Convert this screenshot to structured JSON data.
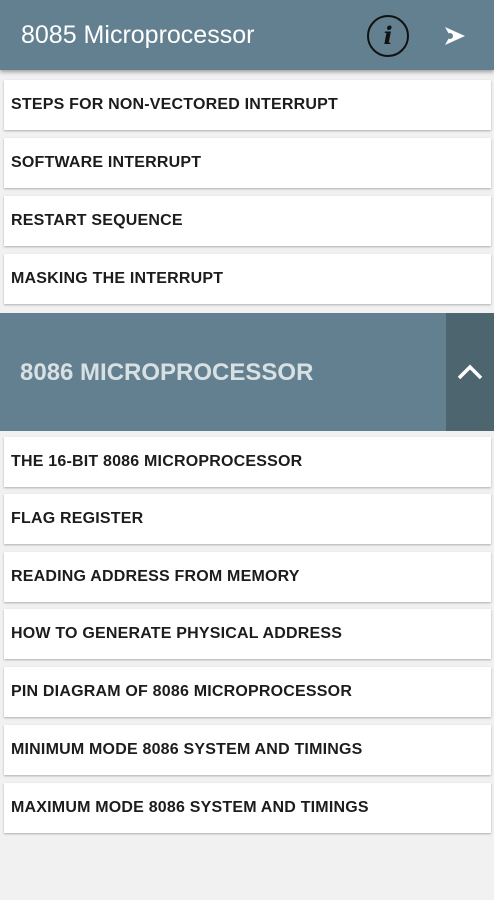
{
  "appbar": {
    "title": "8085 Microprocessor",
    "info_icon": "info-icon",
    "share_icon": "share-icon"
  },
  "group_8085": {
    "items": [
      {
        "label": "STEPS FOR NON-VECTORED INTERRUPT"
      },
      {
        "label": "SOFTWARE INTERRUPT"
      },
      {
        "label": "RESTART SEQUENCE"
      },
      {
        "label": "MASKING THE INTERRUPT"
      }
    ]
  },
  "group_8086": {
    "title": "8086 MICROPROCESSOR",
    "collapse_icon": "chevron-up-icon",
    "items": [
      {
        "label": "THE 16-BIT 8086 MICROPROCESSOR"
      },
      {
        "label": "FLAG REGISTER"
      },
      {
        "label": "READING ADDRESS FROM MEMORY"
      },
      {
        "label": "HOW TO GENERATE PHYSICAL ADDRESS"
      },
      {
        "label": "PIN DIAGRAM OF 8086 MICROPROCESSOR"
      },
      {
        "label": "MINIMUM MODE 8086 SYSTEM AND TIMINGS"
      },
      {
        "label": "MAXIMUM MODE 8086 SYSTEM AND TIMINGS"
      }
    ]
  },
  "colors": {
    "appbar": "#62808f",
    "collapse_button": "#4d656f",
    "background": "#f1f1f1"
  }
}
